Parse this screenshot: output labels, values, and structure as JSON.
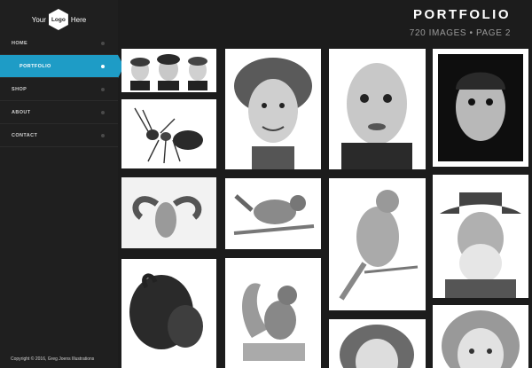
{
  "logo": {
    "left": "Your",
    "center": "Logo",
    "right": "Here"
  },
  "nav": {
    "items": [
      {
        "label": "HOME"
      },
      {
        "label": "PORTFOLIO"
      },
      {
        "label": "SHOP"
      },
      {
        "label": "ABOUT"
      },
      {
        "label": "CONTACT"
      }
    ]
  },
  "header": {
    "title": "PORTFOLIO",
    "subtitle": "720 IMAGES • PAGE 2"
  },
  "footer": {
    "copyright": "Copyright © 2016, Greg Joens Illustrations"
  },
  "colors": {
    "accent": "#1e9cc6",
    "background": "#1c1c1c",
    "sidebar": "#1f1f1f"
  }
}
